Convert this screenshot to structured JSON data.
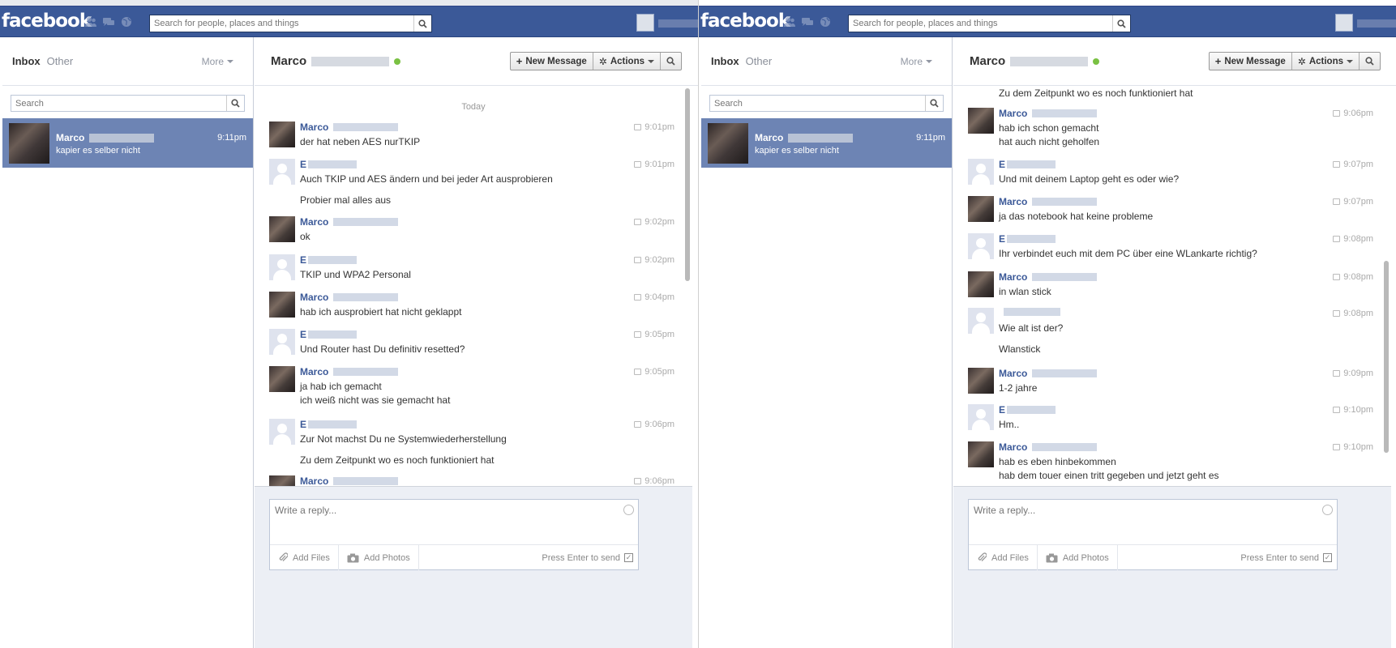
{
  "app": {
    "logo": "facebook",
    "search_placeholder": "Search for people, places and things"
  },
  "inbox": {
    "inbox_tab": "Inbox",
    "other_tab": "Other",
    "more": "More",
    "search_placeholder": "Search",
    "thread": {
      "name": "Marco",
      "time": "9:11pm",
      "snippet": "kapier es selber nicht"
    }
  },
  "conversation": {
    "name": "Marco",
    "new_message": "New Message",
    "actions": "Actions",
    "day_label": "Today",
    "composer_placeholder": "Write a reply...",
    "add_files": "Add Files",
    "add_photos": "Add Photos",
    "press_enter": "Press Enter to send",
    "send_checked": true
  },
  "screens": [
    {
      "messages": [
        {
          "sender": "Marco",
          "kind": "marco",
          "time": "9:01pm",
          "lines": [
            "der hat neben AES nurTKIP"
          ]
        },
        {
          "sender": "E",
          "kind": "e",
          "time": "9:01pm",
          "lines": [
            "Auch TKIP und AES ändern und bei jeder Art ausprobieren",
            "",
            "Probier mal alles aus"
          ]
        },
        {
          "sender": "Marco",
          "kind": "marco",
          "time": "9:02pm",
          "lines": [
            "ok"
          ]
        },
        {
          "sender": "E",
          "kind": "e",
          "time": "9:02pm",
          "lines": [
            "TKIP und WPA2 Personal"
          ]
        },
        {
          "sender": "Marco",
          "kind": "marco",
          "time": "9:04pm",
          "lines": [
            "hab ich ausprobiert hat nicht geklappt"
          ]
        },
        {
          "sender": "E",
          "kind": "e",
          "time": "9:05pm",
          "lines": [
            "Und Router hast Du definitiv resetted?"
          ]
        },
        {
          "sender": "Marco",
          "kind": "marco",
          "time": "9:05pm",
          "lines": [
            "ja hab ich gemacht",
            "ich weiß nicht was sie gemacht hat"
          ]
        },
        {
          "sender": "E",
          "kind": "e",
          "time": "9:06pm",
          "lines": [
            "Zur Not machst Du ne Systemwiederherstellung",
            "",
            "Zu dem Zeitpunkt wo es noch funktioniert hat"
          ]
        },
        {
          "sender": "Marco",
          "kind": "marco",
          "time": "9:06pm",
          "lines": [
            "hab ich schon gemacht"
          ]
        }
      ]
    },
    {
      "messages": [
        {
          "sender": "",
          "kind": "cont",
          "time": "",
          "lines": [
            "Zu dem Zeitpunkt wo es noch funktioniert hat"
          ]
        },
        {
          "sender": "Marco",
          "kind": "marco",
          "time": "9:06pm",
          "lines": [
            "hab ich schon gemacht",
            "hat auch nicht geholfen"
          ]
        },
        {
          "sender": "E",
          "kind": "e",
          "time": "9:07pm",
          "lines": [
            "Und mit deinem Laptop geht es oder wie?"
          ]
        },
        {
          "sender": "Marco",
          "kind": "marco",
          "time": "9:07pm",
          "lines": [
            "ja das notebook hat keine probleme"
          ]
        },
        {
          "sender": "E",
          "kind": "e",
          "time": "9:08pm",
          "lines": [
            "Ihr verbindet euch mit dem PC über eine WLankarte richtig?"
          ]
        },
        {
          "sender": "Marco",
          "kind": "marco",
          "time": "9:08pm",
          "lines": [
            "in wlan stick"
          ]
        },
        {
          "sender": "",
          "kind": "e",
          "time": "9:08pm",
          "lines": [
            "Wie alt ist der?",
            "",
            "Wlanstick"
          ]
        },
        {
          "sender": "Marco",
          "kind": "marco",
          "time": "9:09pm",
          "lines": [
            "1-2 jahre"
          ]
        },
        {
          "sender": "E",
          "kind": "e",
          "time": "9:10pm",
          "lines": [
            "Hm.."
          ]
        },
        {
          "sender": "Marco",
          "kind": "marco",
          "time": "9:10pm",
          "lines": [
            "hab es eben hinbekommen",
            "hab dem touer einen tritt gegeben und jetzt geht es"
          ]
        }
      ]
    }
  ],
  "colors": {
    "brand": "#3b5998",
    "selected_thread": "#6d84b4",
    "online": "#7ac143"
  }
}
